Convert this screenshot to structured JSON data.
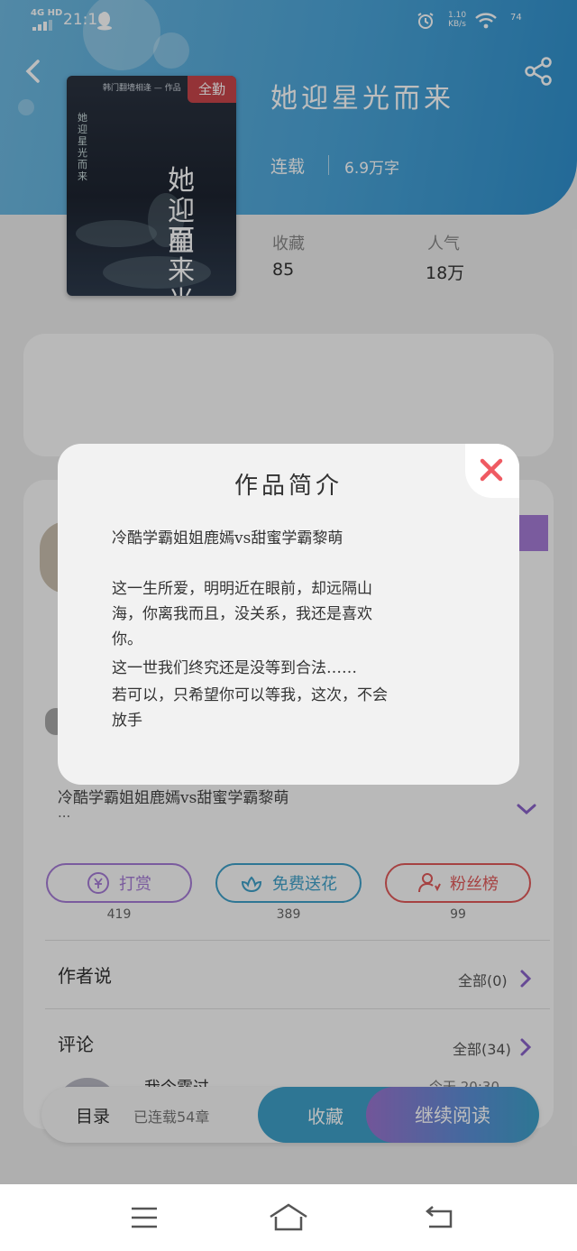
{
  "status_bar": {
    "network": "4G HD",
    "time": "21:10",
    "speed_value": "1.10",
    "speed_unit": "KB/s",
    "battery": "74"
  },
  "book": {
    "title": "她迎星光而来",
    "status": "连载",
    "words": "6.9万字",
    "cover_badge": "全勤",
    "cover_title_a": "她迎星",
    "cover_title_b": "而来光",
    "cover_side": "她迎星光而来",
    "cover_note": "韩门翻墙相逢 — 作品"
  },
  "stats": {
    "fav_label": "收藏",
    "fav_value": "85",
    "pop_label": "人气",
    "pop_value": "18万"
  },
  "intro": {
    "short": "冷酷学霸姐姐鹿嫣vs甜蜜学霸黎萌",
    "more": "..."
  },
  "actions": {
    "reward_label": "打赏",
    "reward_count": "419",
    "flower_label": "免费送花",
    "flower_count": "389",
    "fans_label": "粉丝榜",
    "fans_count": "99"
  },
  "author_say": {
    "title": "作者说",
    "all": "全部(0)"
  },
  "comments": {
    "title": "评论",
    "all": "全部(34)",
    "first_name": "我今露过",
    "first_time": "今天 20:30"
  },
  "bottom_bar": {
    "toc": "目录",
    "chapters": "已连载54章",
    "favorite": "收藏",
    "continue": "继续阅读"
  },
  "modal": {
    "title": "作品简介",
    "lines": [
      "冷酷学霸姐姐鹿嫣vs甜蜜学霸黎萌",
      "这一生所爱，明明近在眼前，却远隔山",
      "海，你离我而且，没关系，我还是喜欢",
      "你。",
      "这一世我们终究还是没等到合法……",
      "若可以，只希望你可以等我，这次，不会",
      "放手"
    ]
  },
  "colors": {
    "header": "#4aa4d8",
    "reward": "#a57bd6",
    "flower": "#3ea0c8",
    "fans": "#e05a5a",
    "close": "#ef5a62"
  }
}
